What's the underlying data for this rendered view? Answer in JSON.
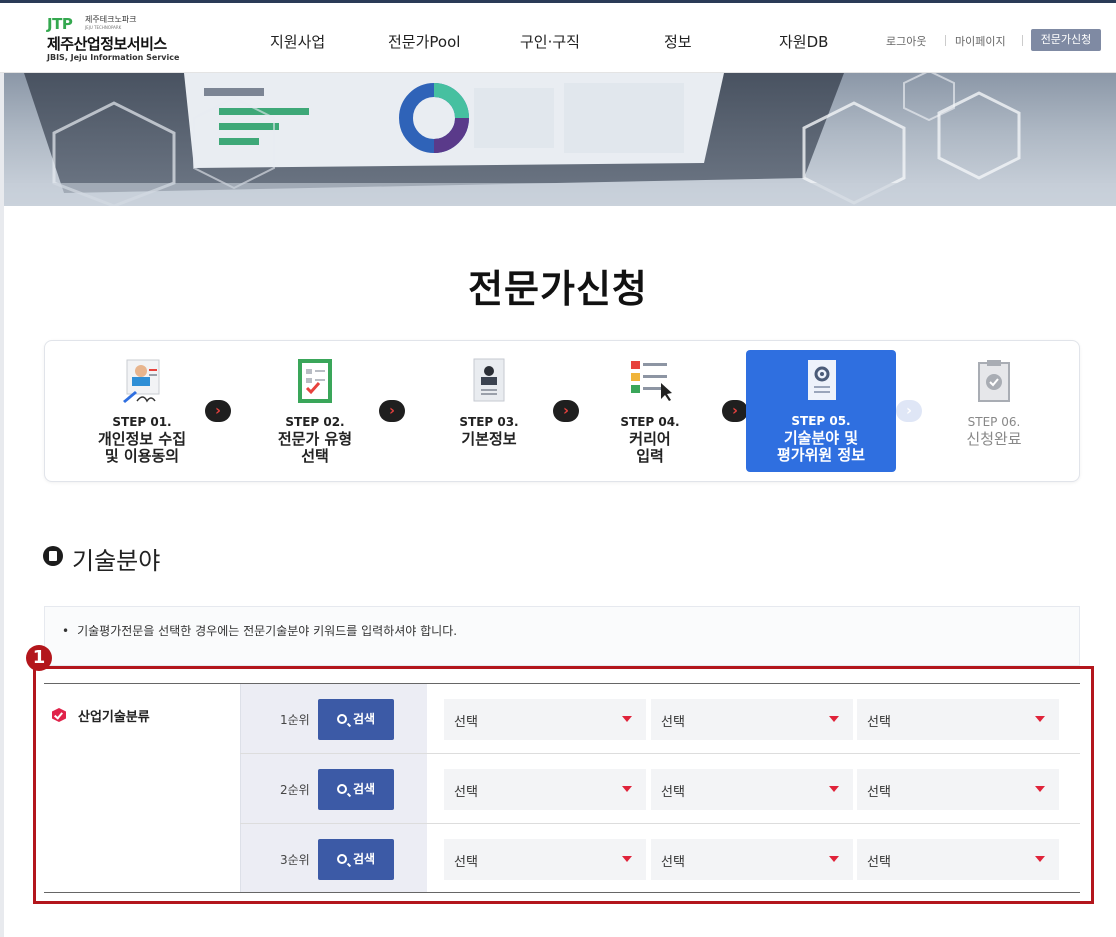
{
  "header": {
    "logo": {
      "brand": "JTP",
      "park_name": "제주테크노파크",
      "park_sub": "JEJU TECHNOPARK",
      "service_name": "제주산업정보서비스",
      "service_sub": "JBIS, Jeju Information Service"
    },
    "nav": [
      "지원사업",
      "전문가Pool",
      "구인·구직",
      "정보",
      "자원DB"
    ],
    "util": {
      "logout": "로그아웃",
      "mypage": "마이페이지",
      "apply": "전문가신청"
    }
  },
  "page_title": "전문가신청",
  "steps": [
    {
      "num": "STEP 01.",
      "label": "개인정보 수집\n및 이용동의",
      "icon": "person-document-icon",
      "state": "normal"
    },
    {
      "num": "STEP 02.",
      "label": "전문가 유형\n선택",
      "icon": "checklist-icon",
      "state": "normal"
    },
    {
      "num": "STEP 03.",
      "label": "기본정보",
      "icon": "profile-document-icon",
      "state": "normal"
    },
    {
      "num": "STEP 04.",
      "label": "커리어\n입력",
      "icon": "list-cursor-icon",
      "state": "normal"
    },
    {
      "num": "STEP 05.",
      "label": "기술분야 및\n평가위원 정보",
      "icon": "gear-document-icon",
      "state": "active"
    },
    {
      "num": "STEP 06.",
      "label": "신청완료",
      "icon": "clipboard-check-icon",
      "state": "pending"
    }
  ],
  "section": {
    "title": "기술분야",
    "notice": "기술평가전문을 선택한 경우에는 전문기술분야 키워드를 입력하셔야 합니다."
  },
  "form": {
    "annotation_number": "1",
    "field_label": "산업기술분류",
    "search_label": "검색",
    "rows": [
      {
        "rank": "1순위",
        "selects": [
          "선택",
          "선택",
          "선택"
        ]
      },
      {
        "rank": "2순위",
        "selects": [
          "선택",
          "선택",
          "선택"
        ]
      },
      {
        "rank": "3순위",
        "selects": [
          "선택",
          "선택",
          "선택"
        ]
      }
    ]
  },
  "colors": {
    "accent_blue": "#2f6fe0",
    "button_blue": "#3c5aa6",
    "highlight_red": "#b3161c",
    "caret_red": "#e0233a"
  }
}
